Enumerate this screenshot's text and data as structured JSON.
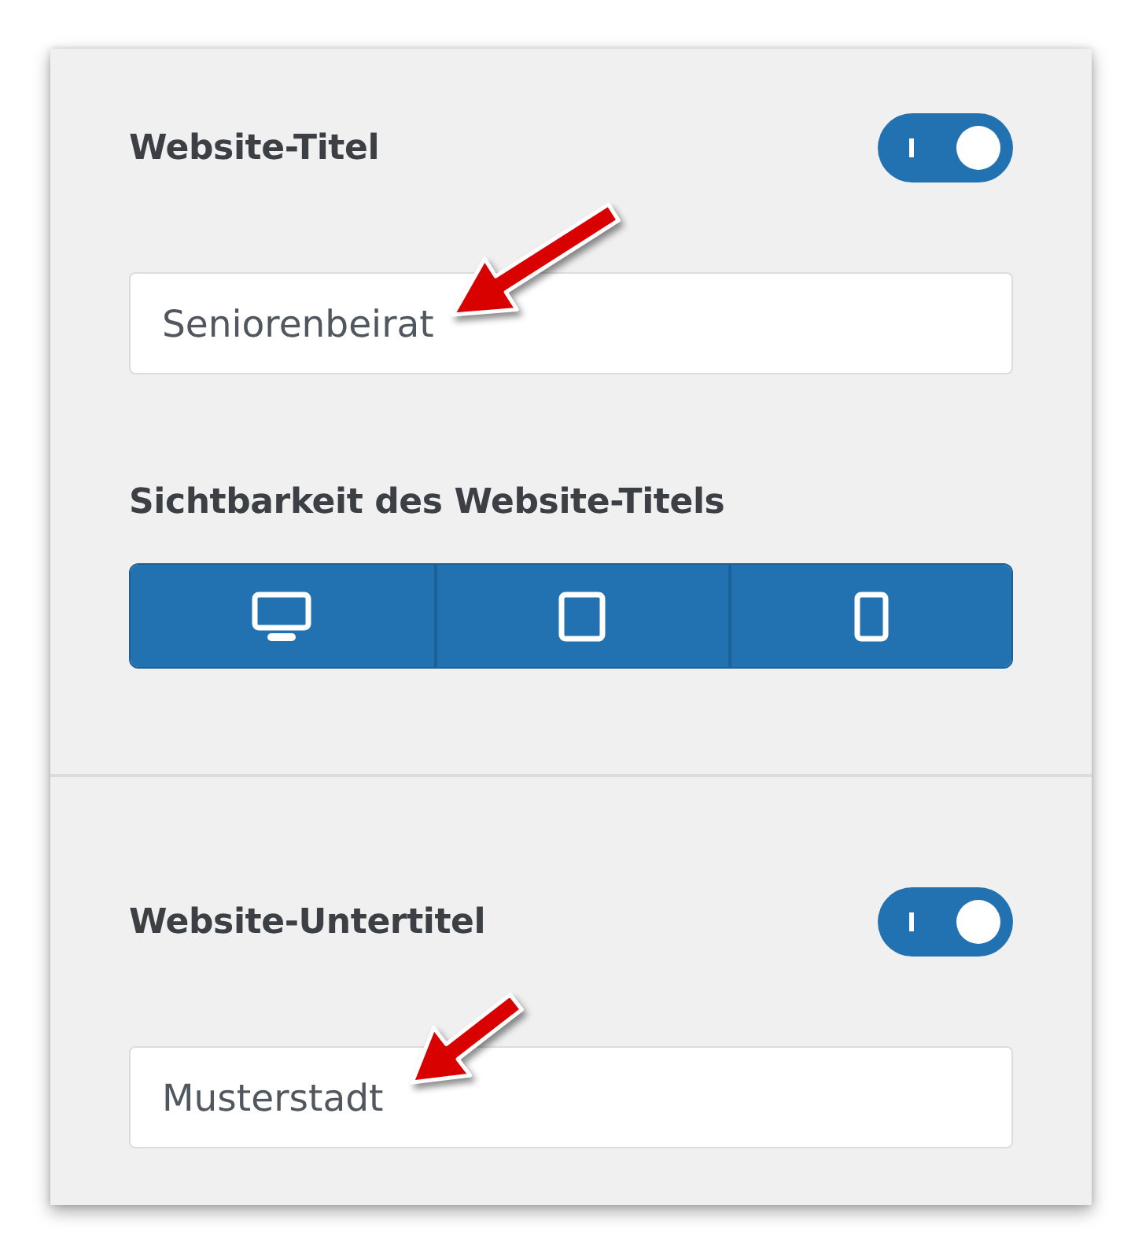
{
  "sections": [
    {
      "label": "Website-Titel",
      "toggle": {
        "on": true
      },
      "field": {
        "value": "Seniorenbeirat",
        "annotated": true
      },
      "visibility": {
        "label": "Sichtbarkeit des Website-Titels",
        "devices": [
          {
            "kind": "desktop",
            "on": true
          },
          {
            "kind": "tablet",
            "on": true
          },
          {
            "kind": "mobile",
            "on": true
          }
        ]
      }
    },
    {
      "label": "Website-Untertitel",
      "toggle": {
        "on": true
      },
      "field": {
        "value": "Musterstadt",
        "annotated": true
      }
    }
  ]
}
